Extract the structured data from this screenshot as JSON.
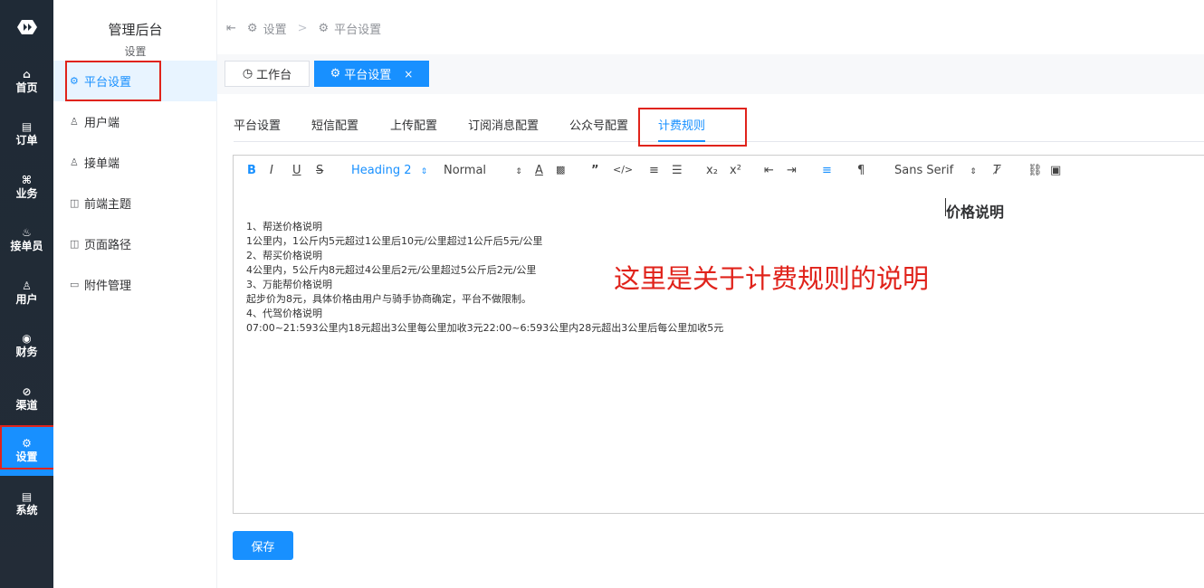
{
  "nav": {
    "items": [
      {
        "icon": "⌂",
        "label": "首页"
      },
      {
        "icon": "▤",
        "label": "订单"
      },
      {
        "icon": "⌘",
        "label": "业务"
      },
      {
        "icon": "♨",
        "label": "接单员"
      },
      {
        "icon": "♙",
        "label": "用户"
      },
      {
        "icon": "◉",
        "label": "财务"
      },
      {
        "icon": "⊘",
        "label": "渠道"
      },
      {
        "icon": "⚙",
        "label": "设置"
      },
      {
        "icon": "▤",
        "label": "系统"
      }
    ],
    "active_index": 7
  },
  "submenu": {
    "title": "管理后台",
    "subtitle": "设置",
    "items": [
      {
        "icon": "⚙",
        "label": "平台设置"
      },
      {
        "icon": "♙",
        "label": "用户端"
      },
      {
        "icon": "♙",
        "label": "接单端"
      },
      {
        "icon": "◫",
        "label": "前端主题"
      },
      {
        "icon": "◫",
        "label": "页面路径"
      },
      {
        "icon": "▭",
        "label": "附件管理"
      }
    ]
  },
  "breadcrumb": {
    "root": "设置",
    "separator": ">",
    "current": "平台设置"
  },
  "tags": [
    {
      "label": "工作台"
    },
    {
      "label": "平台设置",
      "close": "×"
    }
  ],
  "tabs": [
    "平台设置",
    "短信配置",
    "上传配置",
    "订阅消息配置",
    "公众号配置",
    "计费规则"
  ],
  "toolbar": {
    "bold": "B",
    "italic": "I",
    "underline": "U",
    "strike": "S",
    "heading": "Heading 2",
    "size": "Normal",
    "font": "Sans Serif"
  },
  "editor": {
    "heading": "价格说明",
    "lines": [
      "1、帮送价格说明",
      "1公里内，1公斤内5元超过1公里后10元/公里超过1公斤后5元/公里",
      "2、帮买价格说明",
      "4公里内，5公斤内8元超过4公里后2元/公里超过5公斤后2元/公里",
      "3、万能帮价格说明",
      "起步价为8元，具体价格由用户与骑手协商确定，平台不做限制。",
      "4、代驾价格说明",
      "07:00~21:593公里内18元超出3公里每公里加收3元22:00~6:593公里内28元超出3公里后每公里加收5元"
    ]
  },
  "annotation": "这里是关于计费规则的说明",
  "save_label": "保存",
  "colors": {
    "primary": "#1890ff",
    "nav_bg": "#1f2a36",
    "highlight": "#e0231b"
  }
}
